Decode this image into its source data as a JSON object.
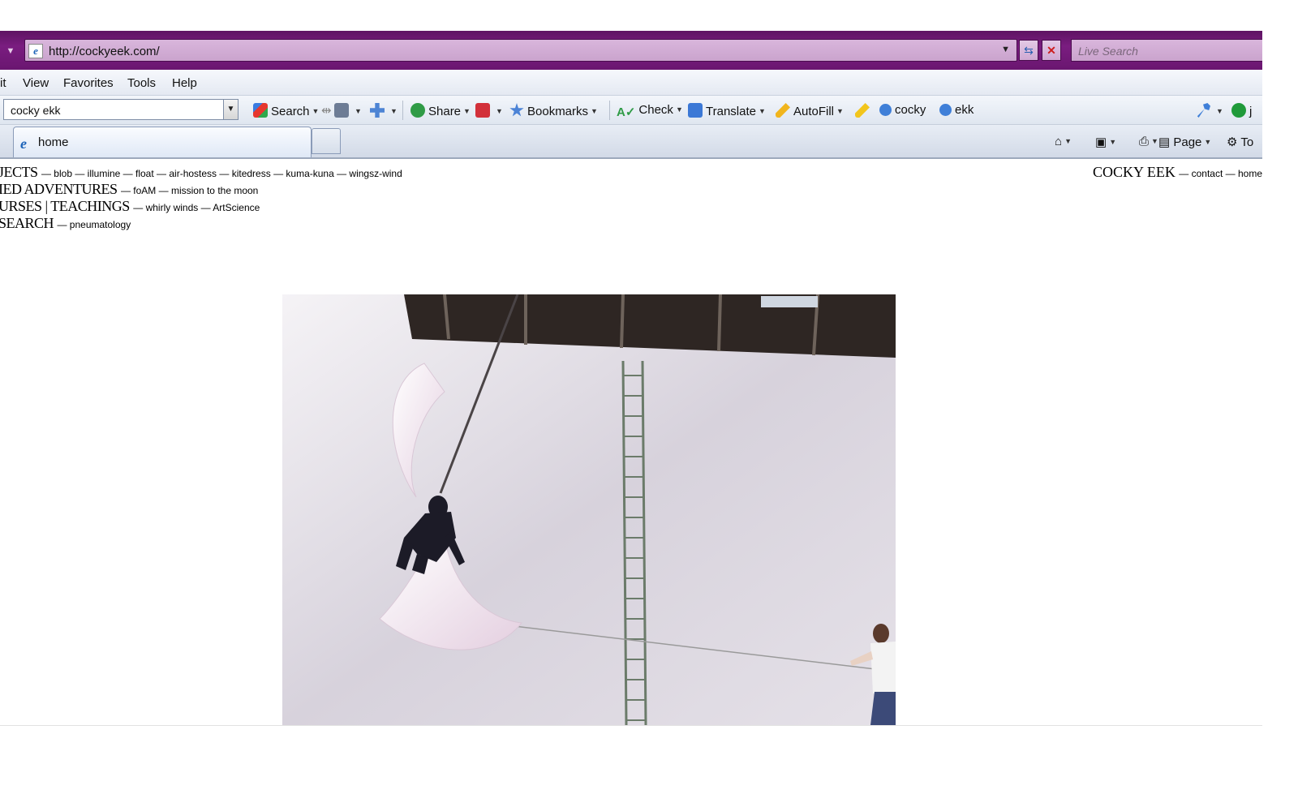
{
  "browser": {
    "address": "http://cockyeek.com/",
    "live_search_placeholder": "Live Search",
    "menu": [
      "it",
      "View",
      "Favorites",
      "Tools",
      "Help"
    ],
    "toolbar": {
      "search_box_value": "cocky ekk",
      "search_label": "Search",
      "share_label": "Share",
      "bookmarks_label": "Bookmarks",
      "check_label": "Check",
      "translate_label": "Translate",
      "autofill_label": "AutoFill",
      "highlight_1": "cocky",
      "highlight_2": "ekk",
      "cut_label": "j"
    },
    "tab": {
      "title": "home"
    },
    "command_bar": {
      "page_label": "Page",
      "tools_label": "To"
    }
  },
  "page": {
    "nav": [
      {
        "head": "JECTS",
        "links": "— blob — illumine — float — air-hostess — kitedress — kuma-kuna — wingsz-wind"
      },
      {
        "head": "IED ADVENTURES",
        "links": "— foAM — mission to the moon"
      },
      {
        "head": "URSES | TEACHINGS",
        "links": "— whirly winds — ArtScience"
      },
      {
        "head": "SEARCH",
        "links": "— pneumatology"
      }
    ],
    "brand": {
      "head": "COCKY EEK",
      "links": "— contact — home"
    }
  },
  "colors": {
    "address_bar": "#6a1670",
    "address_field": "#d2aed5",
    "menu_bg": "#eef1f7",
    "page_bg": "#ffffff"
  }
}
